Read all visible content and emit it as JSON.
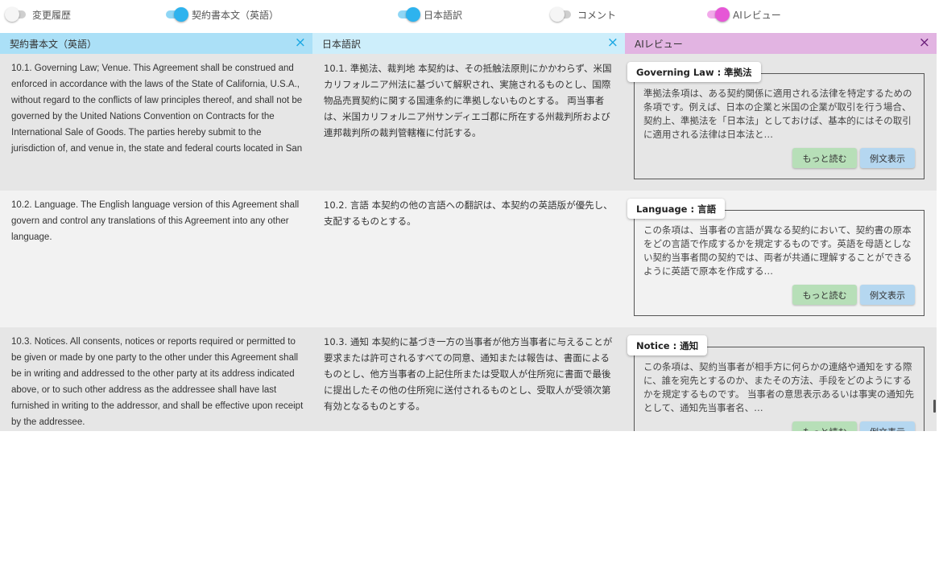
{
  "toggles": [
    {
      "label": "変更履歴",
      "state": "off"
    },
    {
      "label": "契約書本文（英語）",
      "state": "on",
      "color": "#2eb3ee"
    },
    {
      "label": "日本語訳",
      "state": "on",
      "color": "#2eb3ee"
    },
    {
      "label": "コメント",
      "state": "off"
    },
    {
      "label": "AIレビュー",
      "state": "on",
      "color": "#e657d6"
    }
  ],
  "columns": {
    "english": {
      "title": "契約書本文（英語）",
      "close_icon": "×"
    },
    "japanese": {
      "title": "日本語訳",
      "close_icon": "×"
    },
    "ai_review": {
      "title": "AIレビュー",
      "close_icon": "×"
    }
  },
  "colors": {
    "english_header": "#abe0f7",
    "japanese_header": "#cdeefb",
    "ai_header": "#e2b4e2",
    "more_button": "#b7dfb8",
    "example_button": "#b5d7f0"
  },
  "rows": [
    {
      "english": "10.1. Governing Law; Venue. This Agreement shall be construed and enforced in accordance with the laws of the State of California, U.S.A., without regard to the conflicts of law principles thereof, and shall not be governed by the United Nations Convention on Contracts for the International Sale of Goods. The parties hereby submit to the jurisdiction of, and venue in, the state and federal courts located in San",
      "japanese": "10.1. 準拠法、裁判地 本契約は、その抵触法原則にかかわらず、米国カリフォルニア州法に基づいて解釈され、実施されるものとし、国際物品売買契約に関する国連条約に準拠しないものとする。 両当事者は、米国カリフォルニア州サンディエゴ郡に所在する州裁判所および連邦裁判所の裁判管轄権に付託する。",
      "review": {
        "tab": "Governing Law : 準拠法",
        "text": "準拠法条項は、ある契約関係に適用される法律を特定するための条項です。例えば、日本の企業と米国の企業が取引を行う場合、契約上、準拠法を「日本法」としておけば、基本的にはその取引に適用される法律は日本法と…",
        "more_label": "もっと読む",
        "example_label": "例文表示"
      }
    },
    {
      "english": "10.2. Language. The English language version of this Agreement shall govern and control any translations of this Agreement into any other language.",
      "japanese": "10.2. 言語 本契約の他の言語への翻訳は、本契約の英語版が優先し、支配するものとする。",
      "review": {
        "tab": "Language : 言語",
        "text": "この条項は、当事者の言語が異なる契約において、契約書の原本をどの言語で作成するかを規定するものです。英語を母語としない契約当事者間の契約では、両者が共通に理解することができるように英語で原本を作成する…",
        "more_label": "もっと読む",
        "example_label": "例文表示"
      }
    },
    {
      "english": "10.3. Notices. All consents, notices or reports required or permitted to be given or made by one party to the other under this Agreement shall be in writing and addressed to the other party at its address indicated above, or to such other address as the addressee shall have last furnished in writing to the addressor, and shall be effective upon receipt by the addressee.",
      "japanese": "10.3. 通知 本契約に基づき一方の当事者が他方当事者に与えることが要求または許可されるすべての同意、通知または報告は、書面によるものとし、他方当事者の上記住所または受取人が住所宛に書面で最後に提出したその他の住所宛に送付されるものとし、受取人が受領次第有効となるものとする。",
      "review": {
        "tab": "Notice : 通知",
        "text": "この条項は、契約当事者が相手方に何らかの連絡や通知をする際に、誰を宛先とするのか、またその方法、手段をどのようにするかを規定するものです。 当事者の意思表示あるいは事実の通知先として、通知先当事者名、…",
        "more_label": "もっと読む",
        "example_label": "例文表示"
      }
    }
  ]
}
